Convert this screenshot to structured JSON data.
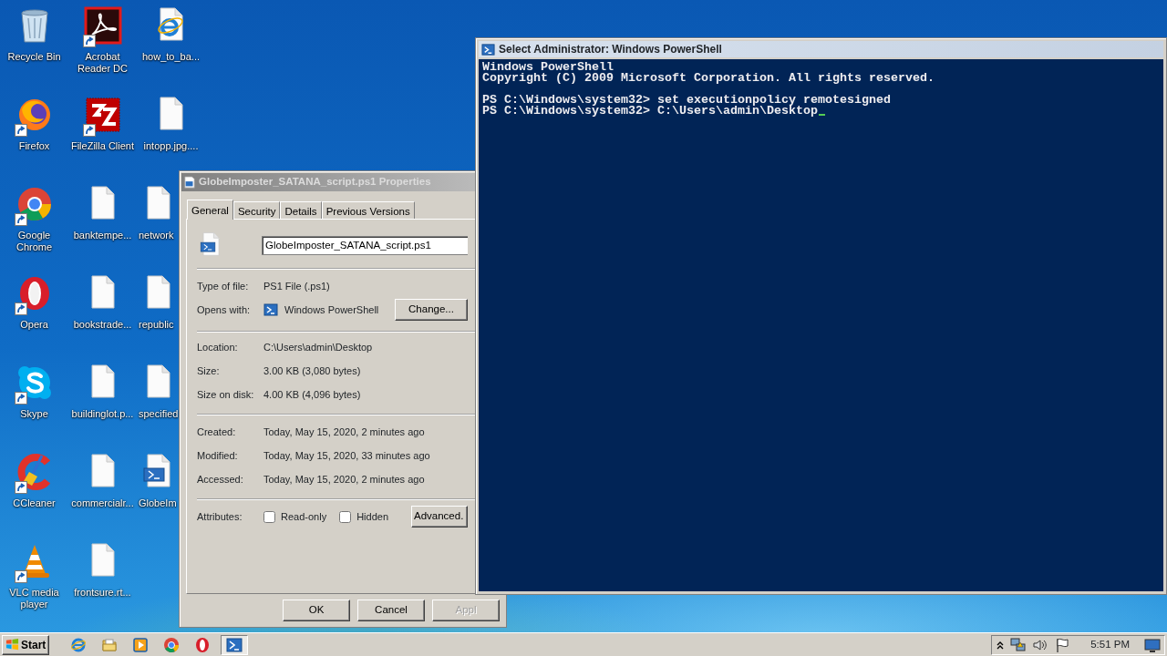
{
  "desktop": {
    "icons": [
      {
        "label": "Recycle Bin",
        "kind": "recycle",
        "shortcut": false
      },
      {
        "label": "Firefox",
        "kind": "firefox",
        "shortcut": true
      },
      {
        "label": "Google Chrome",
        "kind": "chrome",
        "shortcut": true
      },
      {
        "label": "Opera",
        "kind": "opera",
        "shortcut": true
      },
      {
        "label": "Skype",
        "kind": "skype",
        "shortcut": true
      },
      {
        "label": "CCleaner",
        "kind": "ccleaner",
        "shortcut": true
      },
      {
        "label": "VLC media player",
        "kind": "vlc",
        "shortcut": true
      },
      {
        "label": "Acrobat Reader DC",
        "kind": "acrobat",
        "shortcut": true
      },
      {
        "label": "FileZilla Client",
        "kind": "filezilla",
        "shortcut": true
      },
      {
        "label": "banktempe...",
        "kind": "document",
        "shortcut": false
      },
      {
        "label": "bookstrade...",
        "kind": "document",
        "shortcut": false
      },
      {
        "label": "buildinglot.p...",
        "kind": "document",
        "shortcut": false
      },
      {
        "label": "commercialr...",
        "kind": "document",
        "shortcut": false
      },
      {
        "label": "frontsure.rt...",
        "kind": "document",
        "shortcut": false
      },
      {
        "label": "how_to_ba...",
        "kind": "web-document",
        "shortcut": false
      },
      {
        "label": "intopp.jpg....",
        "kind": "document",
        "shortcut": false
      },
      {
        "label": "network",
        "kind": "document",
        "shortcut": false
      },
      {
        "label": "republic",
        "kind": "document",
        "shortcut": false
      },
      {
        "label": "specified",
        "kind": "document",
        "shortcut": false
      },
      {
        "label": "GlobeIm",
        "kind": "script-document",
        "shortcut": false
      }
    ]
  },
  "properties_dialog": {
    "title": "GlobeImposter_SATANA_script.ps1 Properties",
    "tabs": [
      {
        "label": "General",
        "selected": true
      },
      {
        "label": "Security",
        "selected": false
      },
      {
        "label": "Details",
        "selected": false
      },
      {
        "label": "Previous Versions",
        "selected": false
      }
    ],
    "file_name": "GlobeImposter_SATANA_script.ps1",
    "groups": [
      [
        {
          "label": "Type of file:",
          "value": "PS1 File (.ps1)"
        },
        {
          "label": "Opens with:",
          "value": "Windows PowerShell",
          "button": "Change..."
        }
      ],
      [
        {
          "label": "Location:",
          "value": "C:\\Users\\admin\\Desktop"
        },
        {
          "label": "Size:",
          "value": "3.00 KB (3,080 bytes)"
        },
        {
          "label": "Size on disk:",
          "value": "4.00 KB (4,096 bytes)"
        }
      ],
      [
        {
          "label": "Created:",
          "value": "Today, May 15, 2020, 2 minutes ago"
        },
        {
          "label": "Modified:",
          "value": "Today, May 15, 2020, 33 minutes ago"
        },
        {
          "label": "Accessed:",
          "value": "Today, May 15, 2020, 2 minutes ago"
        }
      ]
    ],
    "attributes": {
      "label": "Attributes:",
      "checkboxes": [
        {
          "label": "Read-only",
          "checked": false
        },
        {
          "label": "Hidden",
          "checked": false
        }
      ],
      "button": "Advanced."
    },
    "buttons": [
      {
        "label": "OK",
        "disabled": false
      },
      {
        "label": "Cancel",
        "disabled": false
      },
      {
        "label": "Appl",
        "disabled": true
      }
    ]
  },
  "powershell": {
    "title": "Select Administrator: Windows PowerShell",
    "blocks": [
      [
        "Windows PowerShell",
        "Copyright (C) 2009 Microsoft Corporation. All rights reserved."
      ],
      [
        "PS C:\\Windows\\system32> set executionpolicy remotesigned",
        "PS C:\\Windows\\system32> C:\\Users\\admin\\Desktop"
      ]
    ]
  },
  "taskbar": {
    "start": "Start",
    "items": [
      {
        "kind": "browser",
        "selected": false
      },
      {
        "kind": "folder",
        "selected": false
      },
      {
        "kind": "media",
        "selected": false
      },
      {
        "kind": "chrome",
        "selected": false
      },
      {
        "kind": "opera",
        "selected": false
      },
      {
        "kind": "powershell",
        "selected": true
      }
    ],
    "clock": "5:51 PM"
  }
}
